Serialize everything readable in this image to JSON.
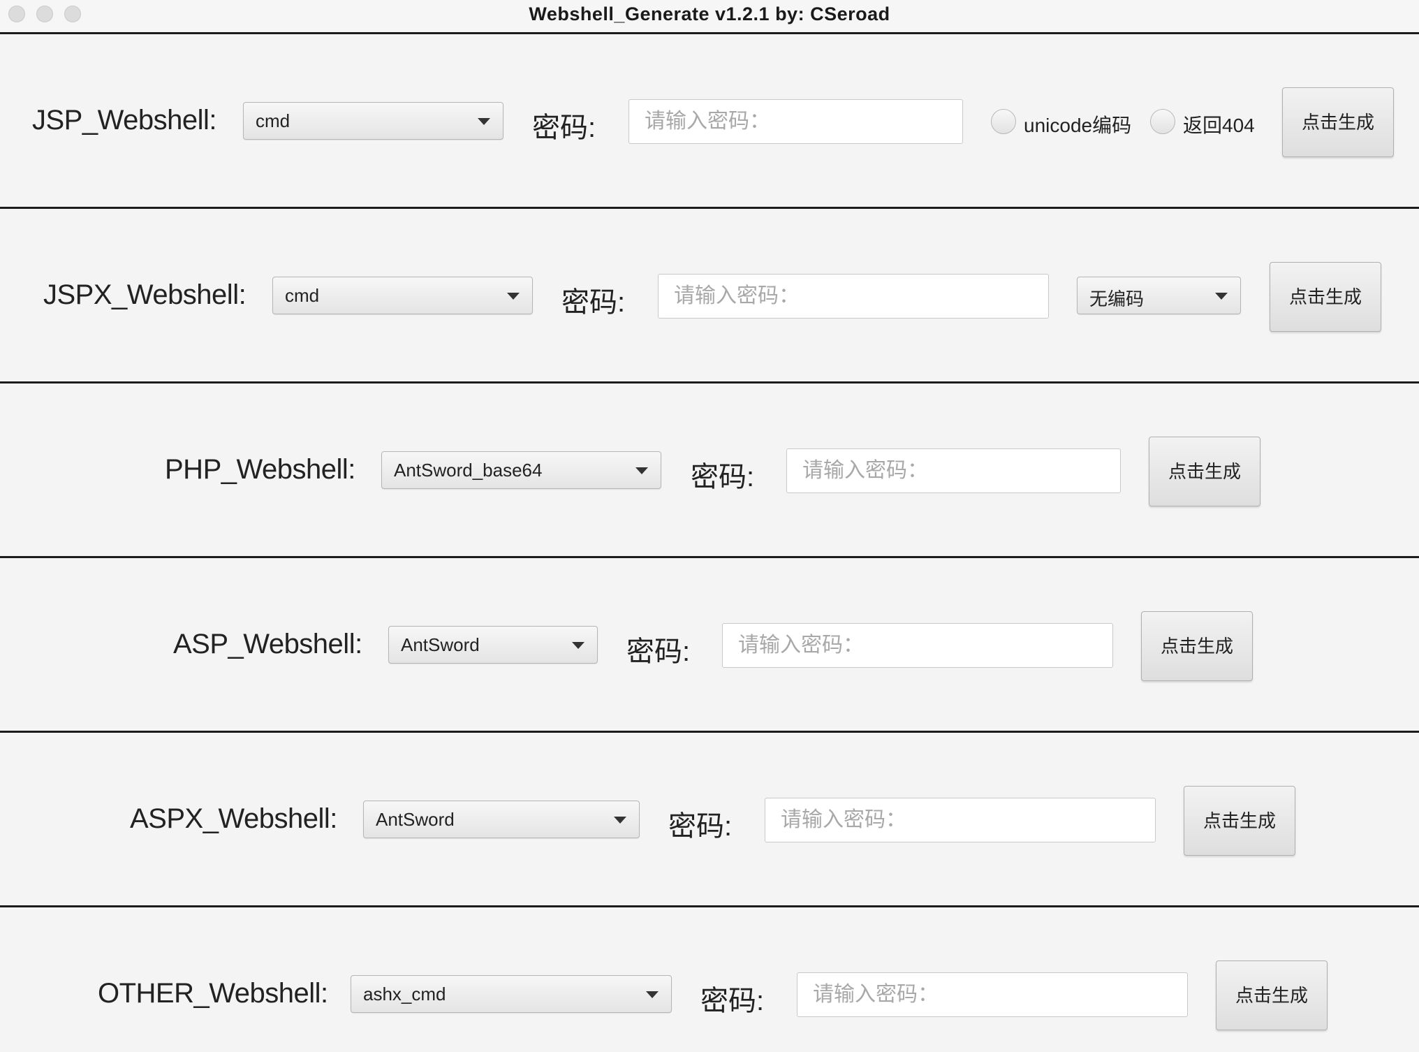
{
  "window": {
    "title": "Webshell_Generate v1.2.1  by: CSeroad"
  },
  "rows": [
    {
      "label": "JSP_Webshell:",
      "type_value": "cmd",
      "password_label": "密码:",
      "password_placeholder": "请输入密码：",
      "options": [
        {
          "label": "unicode编码",
          "checked": false
        },
        {
          "label": "返回404",
          "checked": false
        }
      ],
      "button": "点击生成"
    },
    {
      "label": "JSPX_Webshell:",
      "type_value": "cmd",
      "password_label": "密码:",
      "password_placeholder": "请输入密码：",
      "encoding_value": "无编码",
      "button": "点击生成"
    },
    {
      "label": "PHP_Webshell:",
      "type_value": "AntSword_base64",
      "password_label": "密码:",
      "password_placeholder": "请输入密码：",
      "button": "点击生成"
    },
    {
      "label": "ASP_Webshell:",
      "type_value": "AntSword",
      "password_label": "密码:",
      "password_placeholder": "请输入密码：",
      "button": "点击生成"
    },
    {
      "label": "ASPX_Webshell:",
      "type_value": "AntSword",
      "password_label": "密码:",
      "password_placeholder": "请输入密码：",
      "button": "点击生成"
    },
    {
      "label": "OTHER_Webshell:",
      "type_value": "ashx_cmd",
      "password_label": "密码:",
      "password_placeholder": "请输入密码：",
      "button": "点击生成"
    }
  ]
}
